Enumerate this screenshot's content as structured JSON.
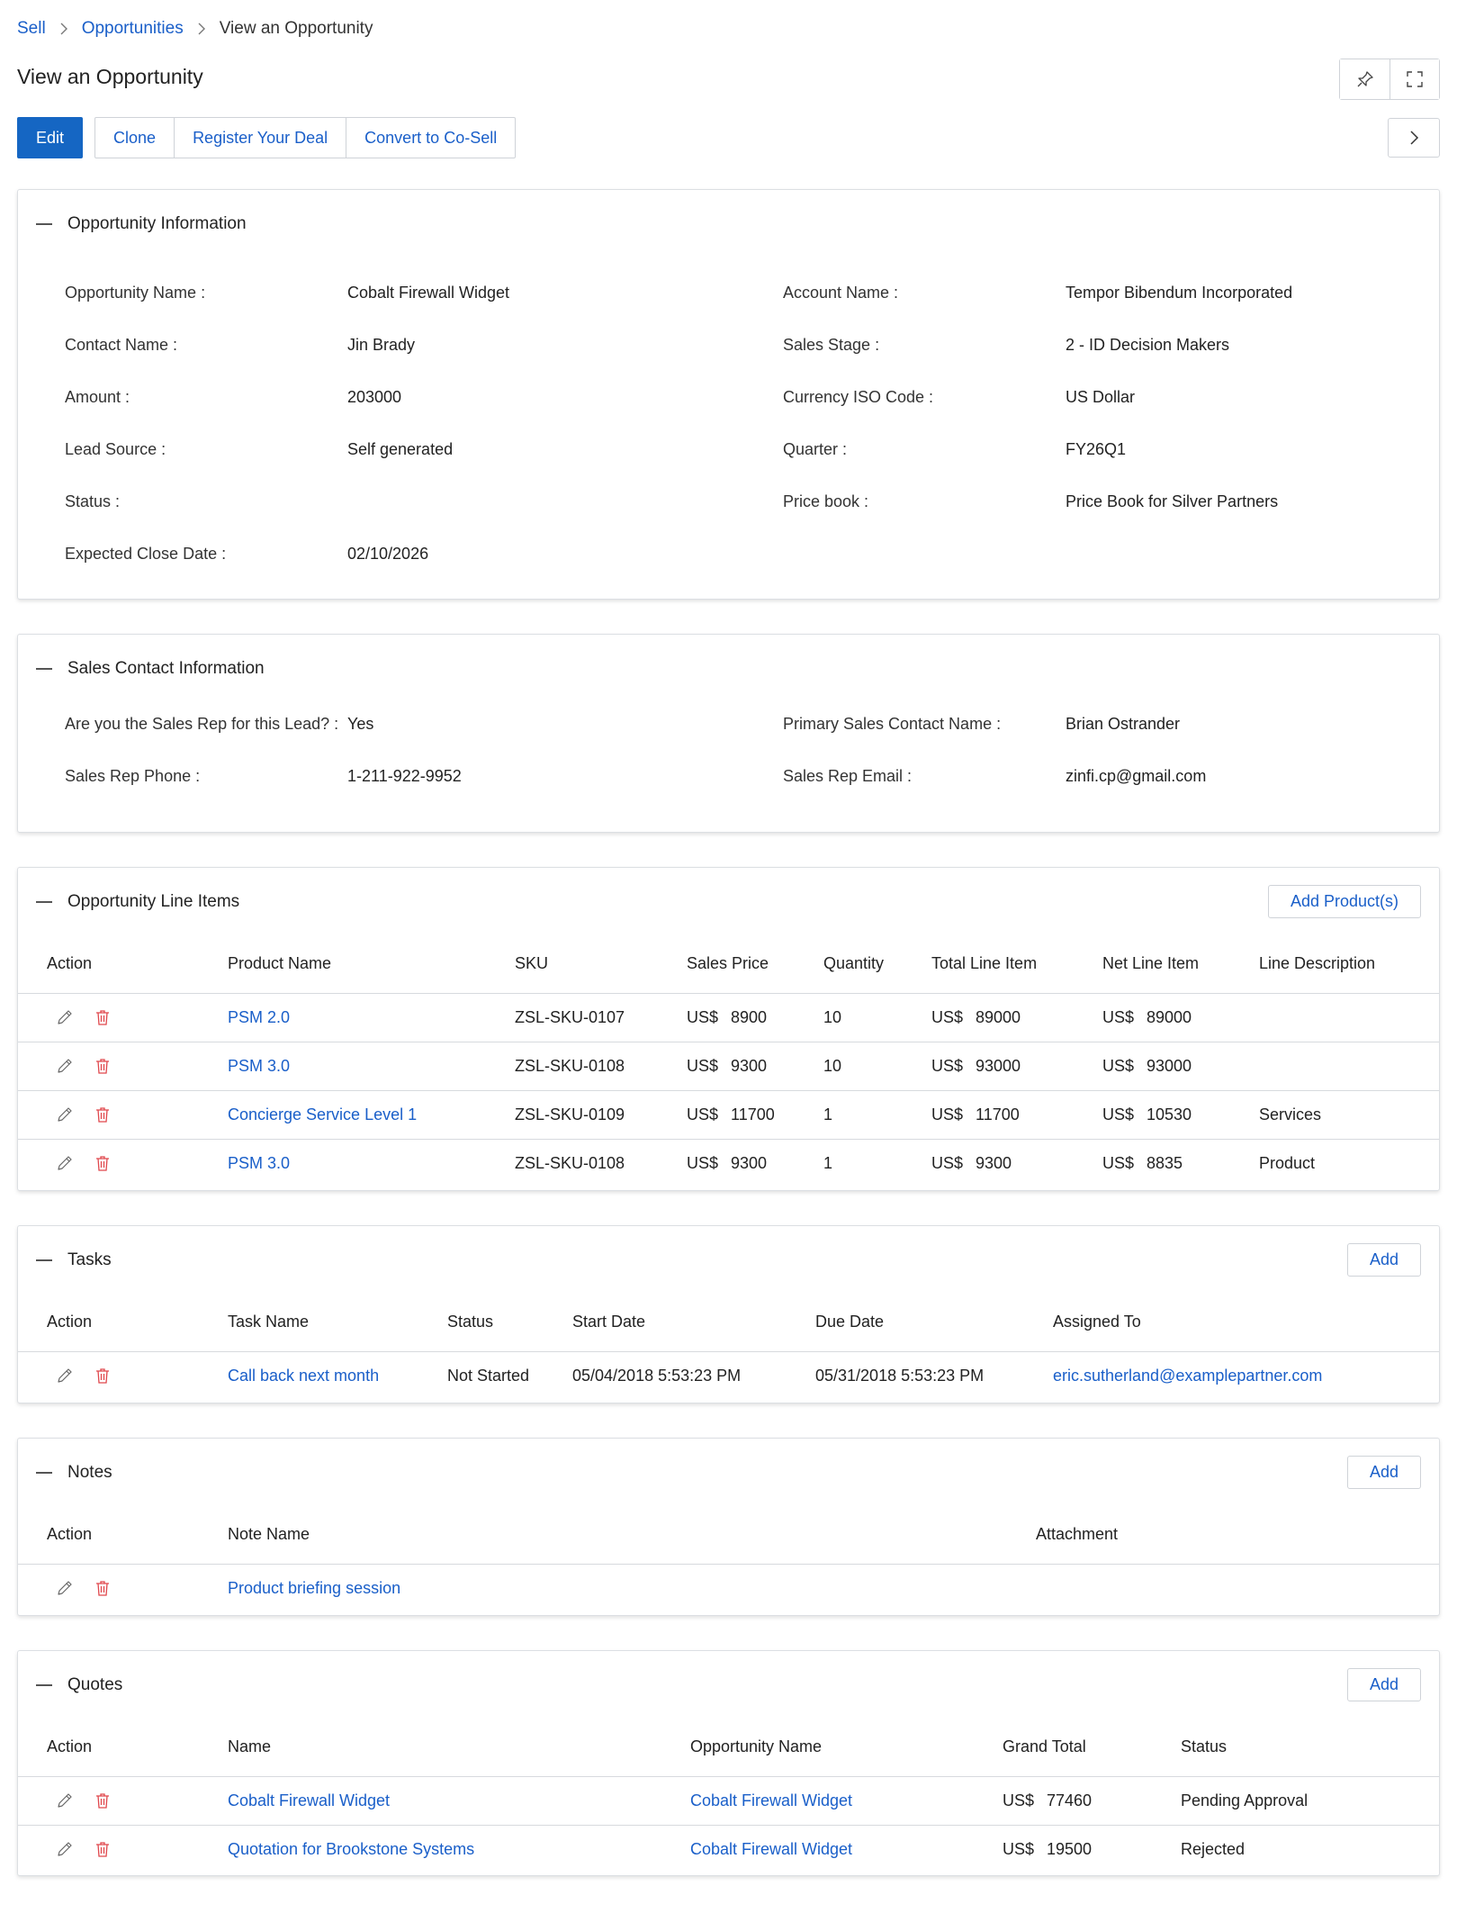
{
  "breadcrumb": {
    "items": [
      "Sell",
      "Opportunities"
    ],
    "current": "View an Opportunity"
  },
  "page_title": "View an Opportunity",
  "toolbar": {
    "edit": "Edit",
    "clone": "Clone",
    "register": "Register Your Deal",
    "convert": "Convert to Co-Sell"
  },
  "icons": {
    "pin": "pin-icon",
    "expand": "expand-icon",
    "next": "chevron-right-icon",
    "edit": "pencil-icon",
    "delete": "trash-icon"
  },
  "colors": {
    "link": "#1a5fc9",
    "primary": "#1566c3",
    "delete": "#e0474c"
  },
  "opportunity": {
    "title": "Opportunity Information",
    "fields": [
      {
        "label": "Opportunity Name :",
        "value": "Cobalt Firewall Widget",
        "link": false
      },
      {
        "label": "Account Name :",
        "value": "Tempor Bibendum Incorporated",
        "link": true
      },
      {
        "label": "Contact Name :",
        "value": "Jin Brady",
        "link": true
      },
      {
        "label": "Sales Stage :",
        "value": "2 - ID Decision Makers",
        "link": false
      },
      {
        "label": "Amount :",
        "value": "203000",
        "link": false
      },
      {
        "label": "Currency ISO Code :",
        "value": "US Dollar",
        "link": false
      },
      {
        "label": "Lead Source :",
        "value": "Self generated",
        "link": false
      },
      {
        "label": "Quarter :",
        "value": "FY26Q1",
        "link": false
      },
      {
        "label": "Status :",
        "value": "",
        "link": false
      },
      {
        "label": "Price book :",
        "value": "Price Book for Silver Partners",
        "link": true
      },
      {
        "label": "Expected Close Date :",
        "value": "02/10/2026",
        "link": false
      },
      {
        "label": "",
        "value": "",
        "link": false
      }
    ]
  },
  "sales_contact": {
    "title": "Sales Contact Information",
    "fields": [
      {
        "label": "Are you the Sales Rep for this Lead? :",
        "value": "Yes"
      },
      {
        "label": "Primary Sales Contact Name :",
        "value": "Brian Ostrander"
      },
      {
        "label": "Sales Rep Phone :",
        "value": "1-211-922-9952"
      },
      {
        "label": "Sales Rep Email :",
        "value": "zinfi.cp@gmail.com"
      }
    ]
  },
  "line_items": {
    "title": "Opportunity Line Items",
    "add_label": "Add Product(s)",
    "columns": [
      "Action",
      "Product Name",
      "SKU",
      "Sales Price",
      "Quantity",
      "Total Line Item",
      "Net Line Item",
      "Line Description"
    ],
    "currency": "US$",
    "rows": [
      {
        "product": "PSM 2.0",
        "sku": "ZSL-SKU-0107",
        "price": "8900",
        "qty": "10",
        "total": "89000",
        "net": "89000",
        "desc": ""
      },
      {
        "product": "PSM 3.0",
        "sku": "ZSL-SKU-0108",
        "price": "9300",
        "qty": "10",
        "total": "93000",
        "net": "93000",
        "desc": ""
      },
      {
        "product": "Concierge Service Level 1",
        "sku": "ZSL-SKU-0109",
        "price": "11700",
        "qty": "1",
        "total": "11700",
        "net": "10530",
        "desc": "Services"
      },
      {
        "product": "PSM 3.0",
        "sku": "ZSL-SKU-0108",
        "price": "9300",
        "qty": "1",
        "total": "9300",
        "net": "8835",
        "desc": "Product"
      }
    ]
  },
  "tasks": {
    "title": "Tasks",
    "add_label": "Add",
    "columns": [
      "Action",
      "Task Name",
      "Status",
      "Start Date",
      "Due Date",
      "Assigned To"
    ],
    "rows": [
      {
        "name": "Call back next month",
        "status": "Not Started",
        "start": "05/04/2018 5:53:23 PM",
        "due": "05/31/2018 5:53:23 PM",
        "assigned": "eric.sutherland@examplepartner.com"
      }
    ]
  },
  "notes": {
    "title": "Notes",
    "add_label": "Add",
    "columns": [
      "Action",
      "Note Name",
      "Attachment"
    ],
    "rows": [
      {
        "name": "Product briefing session",
        "attachment": ""
      }
    ]
  },
  "quotes": {
    "title": "Quotes",
    "add_label": "Add",
    "columns": [
      "Action",
      "Name",
      "Opportunity Name",
      "Grand Total",
      "Status"
    ],
    "currency": "US$",
    "rows": [
      {
        "name": "Cobalt Firewall Widget",
        "opportunity": "Cobalt Firewall Widget",
        "total": "77460",
        "status": "Pending Approval"
      },
      {
        "name": "Quotation for Brookstone Systems",
        "opportunity": "Cobalt Firewall Widget",
        "total": "19500",
        "status": "Rejected"
      }
    ]
  }
}
